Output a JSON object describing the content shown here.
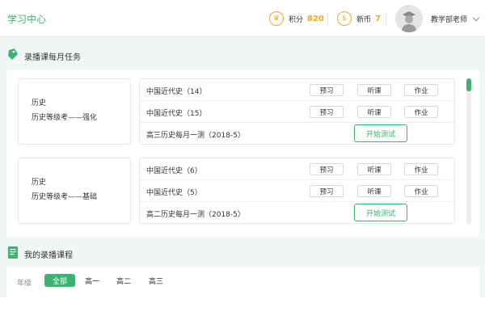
{
  "header": {
    "title": "学习中心",
    "points_icon": "crown-coin-icon",
    "points_label": "积分",
    "points_value": "820",
    "coins_icon": "dollar-coin-icon",
    "coins_label": "新币",
    "coins_value": "7",
    "user_name": "教学部老师"
  },
  "monthly_tasks": {
    "title": "录播课每月任务",
    "courses": [
      {
        "subject": "历史",
        "level": "历史等级考——强化",
        "lessons": [
          {
            "title": "中国近代史（14）",
            "actions": [
              "预习",
              "听课",
              "作业"
            ]
          },
          {
            "title": "中国近代史（15）",
            "actions": [
              "预习",
              "听课",
              "作业"
            ]
          }
        ],
        "test": {
          "title": "高三历史每月一测（2018-5）",
          "button": "开始测试"
        }
      },
      {
        "subject": "历史",
        "level": "历史等级考——基础",
        "lessons": [
          {
            "title": "中国近代史（6）",
            "actions": [
              "预习",
              "听课",
              "作业"
            ]
          },
          {
            "title": "中国近代史（5）",
            "actions": [
              "预习",
              "听课",
              "作业"
            ]
          }
        ],
        "test": {
          "title": "高二历史每月一测（2018-5）",
          "button": "开始测试"
        }
      }
    ]
  },
  "my_courses": {
    "title": "我的录播课程",
    "grade_label": "年级",
    "grades": [
      "全部",
      "高一",
      "高二",
      "高三"
    ],
    "selected_grade": "全部"
  },
  "colors": {
    "accent": "#3cb371",
    "coin": "#f5a623",
    "background": "#f1f7f4"
  }
}
